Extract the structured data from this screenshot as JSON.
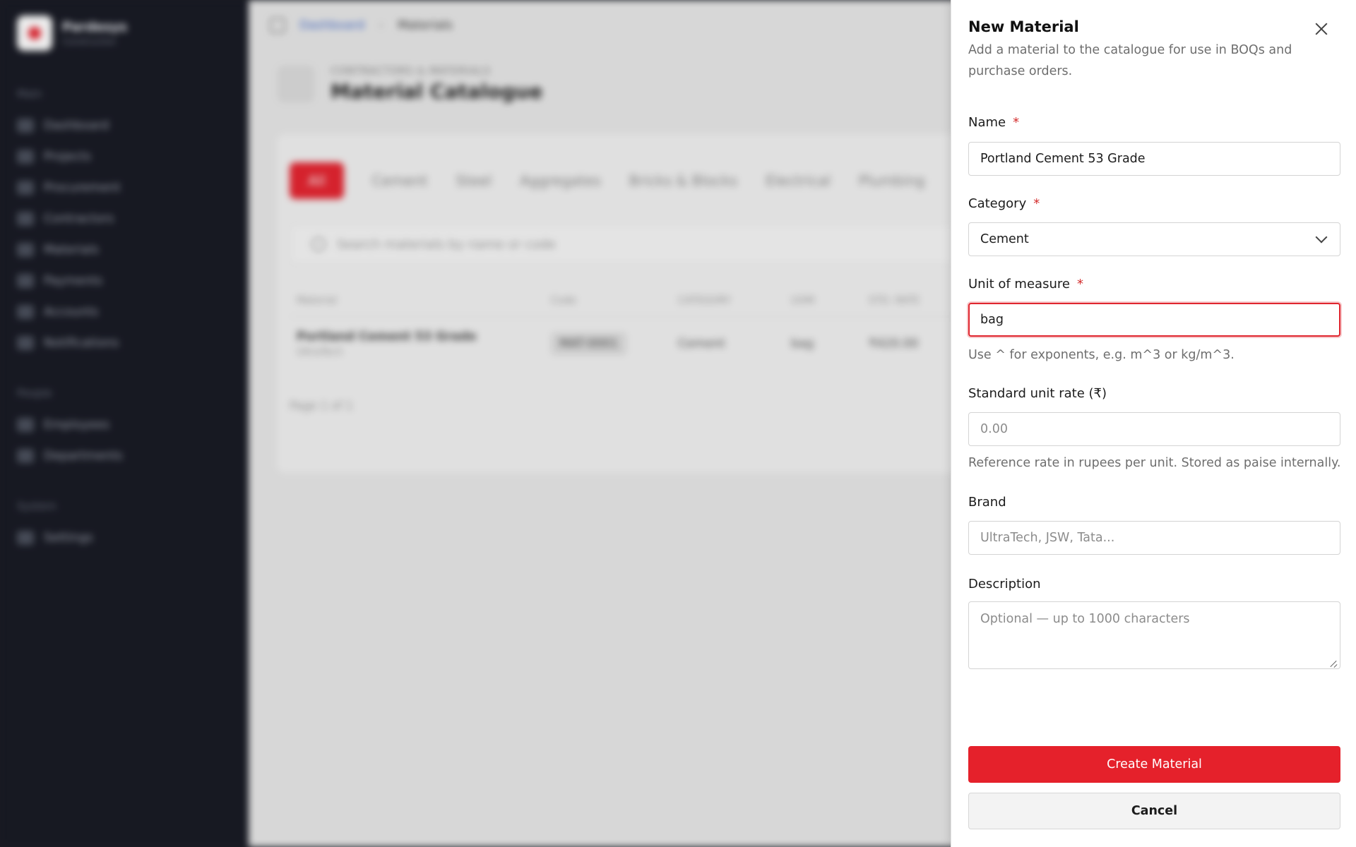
{
  "background": {
    "brand": {
      "name": "Pardesys",
      "subtitle": "Construction"
    },
    "nav_sections": [
      {
        "label": "Main",
        "items": [
          "Dashboard",
          "Projects",
          "Procurement",
          "Contractors",
          "Materials",
          "Payments",
          "Accounts",
          "Notifications"
        ]
      },
      {
        "label": "People",
        "items": [
          "Employees",
          "Departments"
        ]
      },
      {
        "label": "System",
        "items": [
          "Settings"
        ]
      }
    ],
    "breadcrumb": {
      "root": "Dashboard",
      "separator": "›",
      "current": "Materials"
    },
    "page_kicker": "CONTRACTORS & MATERIALS",
    "page_title": "Material Catalogue",
    "filter_tabs": [
      "All",
      "Cement",
      "Steel",
      "Aggregates",
      "Bricks & Blocks",
      "Electrical",
      "Plumbing"
    ],
    "search_placeholder": "Search materials by name or code",
    "table_headers": [
      "Material",
      "Code",
      "CATEGORY",
      "UOM",
      "STD. RATE"
    ],
    "row": {
      "name": "Portland Cement 53 Grade",
      "brand": "UltraTech",
      "code": "MAT-0001",
      "category": "Cement",
      "uom": "bag",
      "rate": "₹420.00"
    },
    "pager": "Page 1 of 1"
  },
  "drawer": {
    "title": "New Material",
    "description": "Add a material to the catalogue for use in BOQs and purchase orders.",
    "required_mark": "*",
    "name": {
      "label": "Name",
      "value": "Portland Cement 53 Grade"
    },
    "category": {
      "label": "Category",
      "value": "Cement"
    },
    "uom": {
      "label": "Unit of measure",
      "value": "bag",
      "help": "Use ^ for exponents, e.g. m^3 or kg/m^3."
    },
    "rate": {
      "label": "Standard unit rate (₹)",
      "placeholder": "0.00",
      "help": "Reference rate in rupees per unit. Stored as paise internally."
    },
    "brand": {
      "label": "Brand",
      "placeholder": "UltraTech, JSW, Tata..."
    },
    "description_field": {
      "label": "Description",
      "placeholder": "Optional — up to 1000 characters"
    },
    "submit_label": "Create Material",
    "cancel_label": "Cancel"
  },
  "colors": {
    "accent": "#e5212b",
    "sidebar": "#171923",
    "focus_ring": "#e0262f"
  },
  "icons": [
    "close-icon",
    "chevron-down-icon",
    "resize-grip-icon",
    "search-icon"
  ]
}
